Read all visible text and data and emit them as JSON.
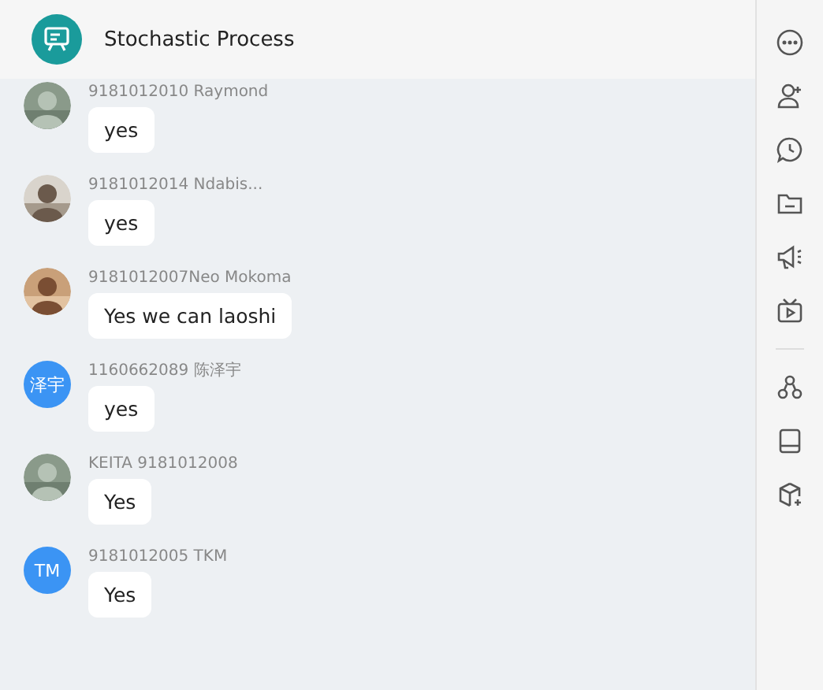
{
  "header": {
    "title": "Stochastic Process"
  },
  "messages": [
    {
      "sender": "9181012010 Raymond",
      "text": "yes"
    },
    {
      "sender": "9181012014 Ndabis...",
      "text": "yes"
    },
    {
      "sender": "9181012007Neo Mokoma",
      "text": "Yes we can laoshi"
    },
    {
      "sender": "1160662089 陈泽宇",
      "text": "yes",
      "avatar": {
        "kind": "initials",
        "initials": "泽宇"
      }
    },
    {
      "sender": "KEITA 9181012008",
      "text": "Yes"
    },
    {
      "sender": "9181012005 TKM",
      "text": "Yes",
      "avatar": {
        "kind": "initials",
        "initials": "TM"
      }
    }
  ]
}
